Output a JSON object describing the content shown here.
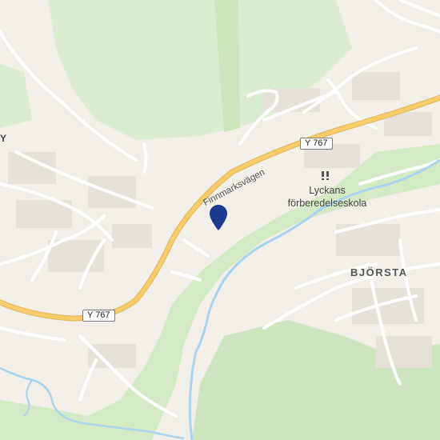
{
  "map": {
    "colors": {
      "land": "#f2efe9",
      "park": "#d6ebc8",
      "forest": "#c8e3b6",
      "water": "#a8d4f0",
      "major_road": "#f9cc6b",
      "minor_road": "#ffffff",
      "building": "#e6e1d9",
      "pin": "#1a3a8f"
    },
    "road_shields": [
      {
        "text": "Y 767"
      },
      {
        "text": "Y 767"
      }
    ],
    "street_labels": [
      {
        "text": "Finnmarksvägen"
      }
    ],
    "place_labels": [
      {
        "text": "BJÖRSTA"
      }
    ],
    "poi": {
      "icon": "school-icon",
      "line1": "Lyckans",
      "line2": "förberedelseskola"
    },
    "edge_label": {
      "text": "Y"
    },
    "marker": {
      "icon": "location-pin-icon"
    }
  }
}
